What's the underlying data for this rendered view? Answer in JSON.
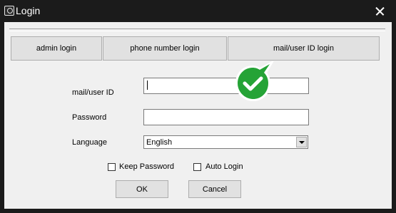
{
  "window": {
    "title": "Login",
    "icon": "app-window-icon",
    "close_icon": "close-icon"
  },
  "login_modes": [
    {
      "label": "admin login"
    },
    {
      "label": "phone number login"
    },
    {
      "label": "mail/user ID login"
    }
  ],
  "fields": {
    "account": {
      "label": "mail/user ID",
      "value": ""
    },
    "password": {
      "label": "Password",
      "value": ""
    },
    "language": {
      "label": "Language",
      "selected": "English"
    }
  },
  "options": {
    "keep_password": {
      "label": "Keep Password",
      "checked": false
    },
    "auto_login": {
      "label": "Auto Login",
      "checked": false
    }
  },
  "actions": {
    "ok": "OK",
    "cancel": "Cancel"
  },
  "overlay": {
    "icon": "checkmark-badge-icon",
    "color": "#25a336"
  }
}
